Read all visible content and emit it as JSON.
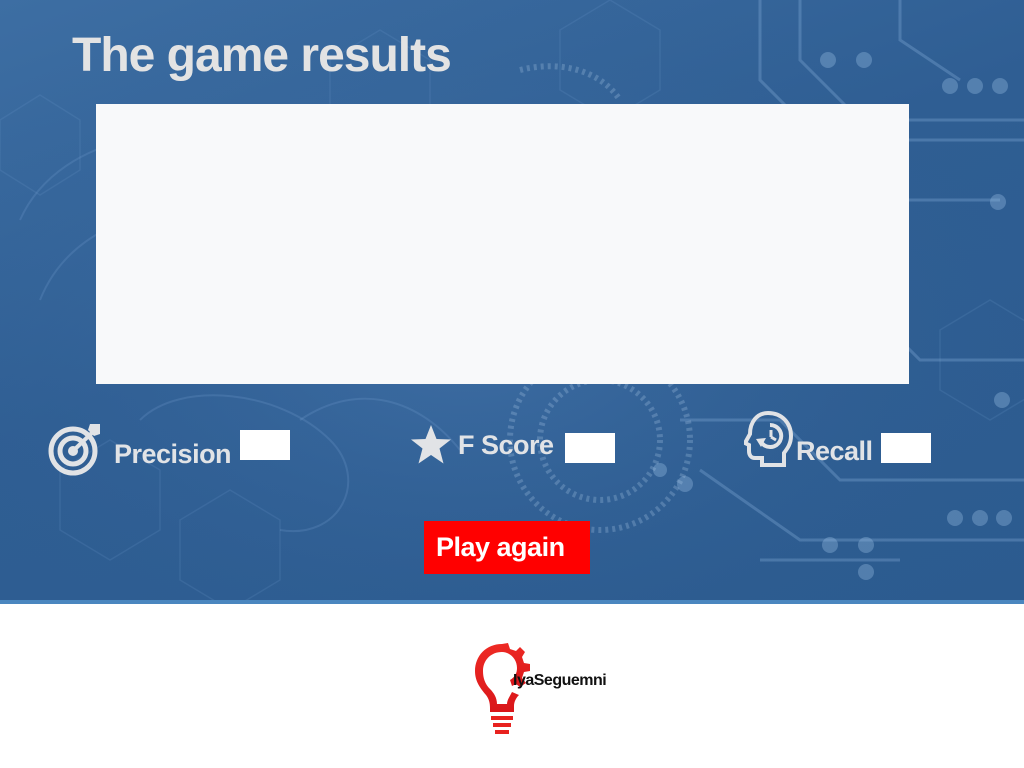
{
  "game": {
    "title": "The game results",
    "results_text": "",
    "play_again_label": "Play again"
  },
  "metrics": {
    "precision": {
      "label": "Precision",
      "value": "",
      "icon": "target-icon"
    },
    "f_score": {
      "label": "F Score",
      "value": "",
      "icon": "star-icon"
    },
    "recall": {
      "label": "Recall",
      "value": "",
      "icon": "head-recall-icon"
    }
  },
  "logo": {
    "text": "IyaSeguemni",
    "icon": "lightbulb-gear-icon"
  },
  "colors": {
    "panel_background": "#2f5e93",
    "title_text": "#e3e3e3",
    "results_area": "#f8f9fa",
    "button_background": "#ff0000",
    "button_text": "#ffffff",
    "logo_red": "#e8221f"
  }
}
